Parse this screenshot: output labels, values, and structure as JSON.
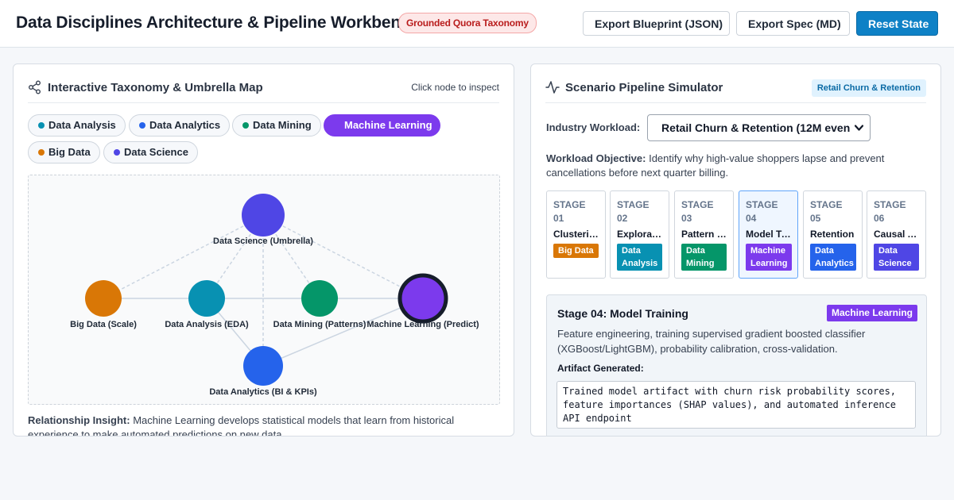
{
  "header": {
    "title": "Data Disciplines Architecture & Pipeline Workbench",
    "badge": "Grounded Quora Taxonomy",
    "export_json": "Export Blueprint (JSON)",
    "export_md": "Export Spec (MD)",
    "reset": "Reset State"
  },
  "colors": {
    "accent": "#0e81c6",
    "data_analysis": "#0891b2",
    "data_analytics": "#2563eb",
    "data_mining": "#059669",
    "machine_learning": "#7c3aed",
    "big_data": "#d97706",
    "data_science": "#4f46e5"
  },
  "taxonomy": {
    "title": "Interactive Taxonomy & Umbrella Map",
    "icon": "share-nodes-icon",
    "hint": "Click node to inspect",
    "chips": [
      {
        "label": "Data Analysis",
        "color": "#0891b2"
      },
      {
        "label": "Data Analytics",
        "color": "#2563eb"
      },
      {
        "label": "Data Mining",
        "color": "#059669"
      },
      {
        "label": "Machine Learning",
        "color": "#7c3aed",
        "active": true
      },
      {
        "label": "Big Data",
        "color": "#d97706"
      },
      {
        "label": "Data Science",
        "color": "#4f46e5"
      }
    ],
    "nodes": [
      {
        "id": "ds",
        "label": "Data Science (Umbrella)",
        "color": "#4f46e5"
      },
      {
        "id": "bd",
        "label": "Big Data (Scale)",
        "color": "#d97706"
      },
      {
        "id": "da",
        "label": "Data Analysis (EDA)",
        "color": "#0891b2"
      },
      {
        "id": "dm",
        "label": "Data Mining (Patterns)",
        "color": "#059669"
      },
      {
        "id": "ml",
        "label": "Machine Learning (Predict)",
        "color": "#7c3aed",
        "selected": true
      },
      {
        "id": "dan",
        "label": "Data Analytics (BI & KPIs)",
        "color": "#2563eb"
      }
    ],
    "insight_label": "Relationship Insight:",
    "insight_text": "Machine Learning develops statistical models that learn from historical experience to make automated predictions on new data."
  },
  "simulator": {
    "title": "Scenario Pipeline Simulator",
    "icon": "activity-icon",
    "badge": "Retail Churn & Retention",
    "workload_label": "Industry Workload:",
    "workload_value": "Retail Churn & Retention (12M even",
    "objective_label": "Workload Objective:",
    "objective_text": "Identify why high-value shoppers lapse and prevent cancellations before next quarter billing.",
    "stages": [
      {
        "num": "STAGE 01",
        "name": "Clustering",
        "tag": "Big Data",
        "color": "#d97706"
      },
      {
        "num": "STAGE 02",
        "name": "Exploration",
        "tag": "Data Analysis",
        "color": "#0891b2"
      },
      {
        "num": "STAGE 03",
        "name": "Pattern Mining",
        "tag": "Data Mining",
        "color": "#059669"
      },
      {
        "num": "STAGE 04",
        "name": "Model Training",
        "tag": "Machine Learning",
        "color": "#7c3aed",
        "active": true
      },
      {
        "num": "STAGE 05",
        "name": "Retention",
        "tag": "Data Analytics",
        "color": "#2563eb"
      },
      {
        "num": "STAGE 06",
        "name": "Causal Analysis",
        "tag": "Data Science",
        "color": "#4f46e5"
      }
    ],
    "detail": {
      "title": "Stage 04: Model Training",
      "badge": "Machine Learning",
      "description": "Feature engineering, training supervised gradient boosted classifier (XGBoost/LightGBM), probability calibration, cross-validation.",
      "artifact_label": "Artifact Generated:",
      "artifact": "Trained model artifact with churn risk probability scores, feature importances (SHAP values), and automated inference API endpoint"
    }
  }
}
